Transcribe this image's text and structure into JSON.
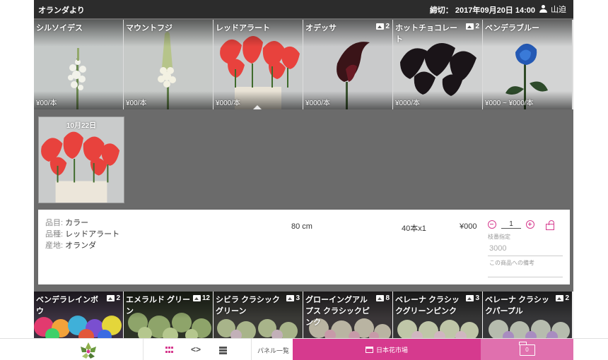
{
  "header": {
    "title": "オランダより",
    "deadline": "締切： 2017年09月20日 14:00",
    "user": "山迫"
  },
  "top_products": [
    {
      "name": "シルソイデス",
      "price": "¥00/本",
      "images": null
    },
    {
      "name": "マウントフジ",
      "price": "¥00/本",
      "images": null
    },
    {
      "name": "レッドアラート",
      "price": "¥000/本",
      "images": null
    },
    {
      "name": "オデッサ",
      "price": "¥000/本",
      "images": "2"
    },
    {
      "name": "ホットチョコレート",
      "price": "¥000/本",
      "images": "2"
    },
    {
      "name": "ベンデラブルー",
      "price": "¥000 ~ ¥000/本",
      "images": null
    }
  ],
  "lot": {
    "date": "10月22日"
  },
  "detail": {
    "item_label": "品目:",
    "item_value": "カラー",
    "variety_label": "品種:",
    "variety_value": "レッドアラート",
    "origin_label": "産地:",
    "origin_value": "オランダ",
    "length": "80 cm",
    "quantity": "40本x1",
    "price": "¥000",
    "order_count": "1",
    "branch_label": "枝番指定",
    "branch_value": "3000",
    "note_placeholder": "この商品への備考"
  },
  "bottom_products": [
    {
      "name": "ベンデラレインボウ",
      "images": "2"
    },
    {
      "name": "エメラルド グリーン",
      "images": "12"
    },
    {
      "name": "シビラ クラシック グリーン",
      "images": "3"
    },
    {
      "name": "グローイングアルプス クラシックピンク",
      "images": "8"
    },
    {
      "name": "ベレーナ クラシックグリーンピンク",
      "images": "3"
    },
    {
      "name": "ベレーナ クラシックパープル",
      "images": "2"
    }
  ],
  "footer": {
    "panel_list": "パネル一覧",
    "market": "日本花市場",
    "cart_count": "0",
    "code_icon_text": "<>"
  },
  "colors": {
    "accent": "#d63a8e",
    "cart": "#e070ae",
    "header": "#2c2c2c",
    "panel_bg": "#6b6b6b"
  },
  "icons": [
    "user-icon",
    "image-icon",
    "minus-circle-icon",
    "plus-circle-icon",
    "unlock-icon",
    "grid-view-icon",
    "code-view-icon",
    "list-view-icon",
    "store-icon",
    "folder-icon",
    "flower-logo"
  ]
}
